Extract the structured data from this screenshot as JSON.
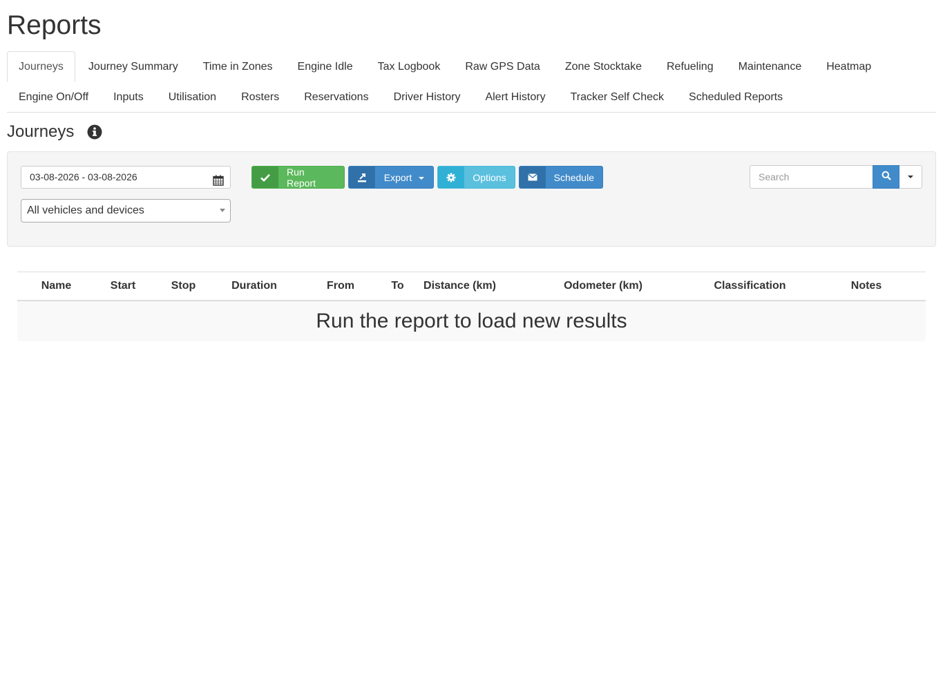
{
  "page": {
    "title": "Reports"
  },
  "tabs": [
    "Journeys",
    "Journey Summary",
    "Time in Zones",
    "Engine Idle",
    "Tax Logbook",
    "Raw GPS Data",
    "Zone Stocktake",
    "Refueling",
    "Maintenance",
    "Heatmap",
    "Engine On/Off",
    "Inputs",
    "Utilisation",
    "Rosters",
    "Reservations",
    "Driver History",
    "Alert History",
    "Tracker Self Check",
    "Scheduled Reports"
  ],
  "active_tab": "Journeys",
  "section": {
    "title": "Journeys",
    "info_icon": "info-circle-icon"
  },
  "filters": {
    "date_range": "03-08-2026 - 03-08-2026",
    "vehicle_select": "All vehicles and devices"
  },
  "buttons": {
    "run_report": "Run Report",
    "export": "Export",
    "options": "Options",
    "schedule": "Schedule"
  },
  "search": {
    "placeholder": "Search"
  },
  "table": {
    "columns": [
      "Name",
      "Start",
      "Stop",
      "Duration",
      "From",
      "To",
      "Distance (km)",
      "Odometer (km)",
      "Classification",
      "Notes"
    ],
    "empty_message": "Run the report to load new results"
  },
  "colors": {
    "success": "#5cb85c",
    "primary": "#428bca",
    "info": "#5bc0de"
  }
}
